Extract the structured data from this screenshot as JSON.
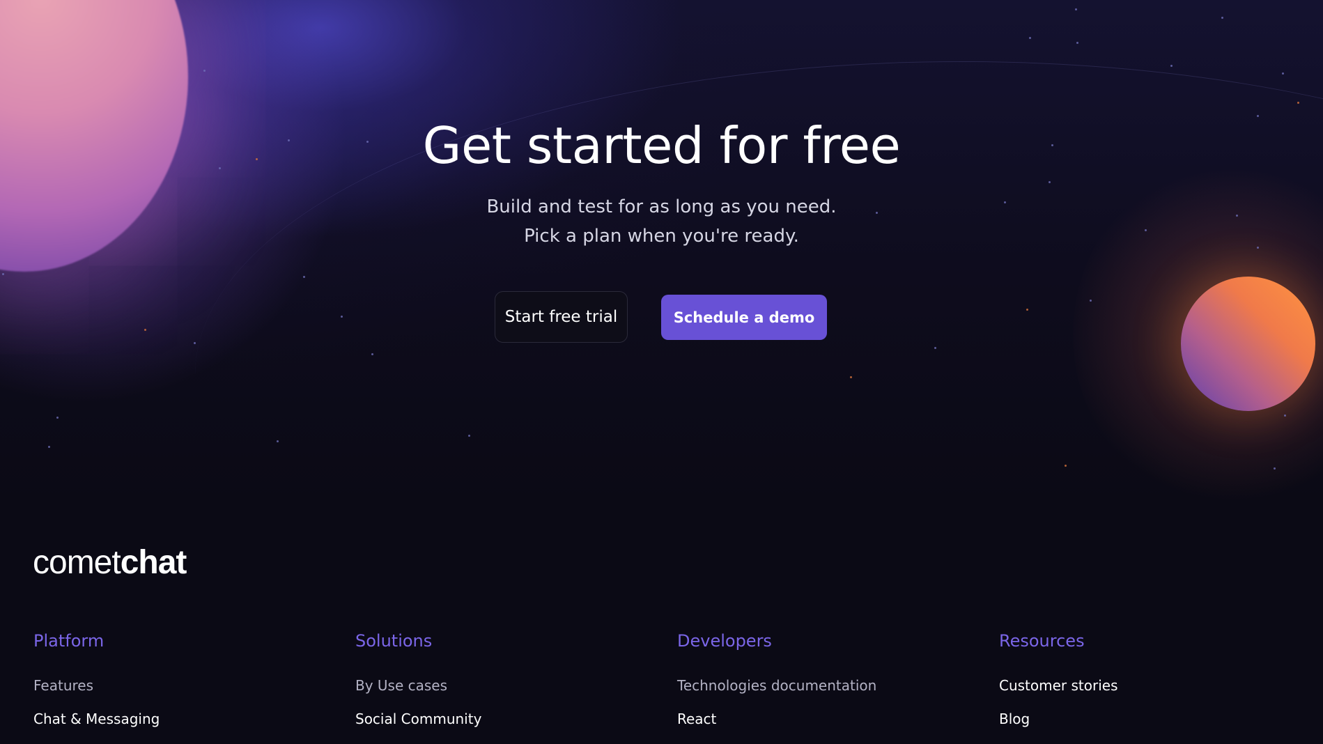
{
  "hero": {
    "title": "Get started for free",
    "subtitle_line1": "Build and test for as long as you need.",
    "subtitle_line2": "Pick a plan when you're ready.",
    "trial_button": "Start free trial",
    "demo_button": "Schedule a demo"
  },
  "colors": {
    "background": "#0b0a15",
    "accent": "#6851d6",
    "footer_heading": "#7b66e8"
  },
  "footer": {
    "logo": {
      "part1": "comet",
      "part2": "chat"
    },
    "columns": [
      {
        "title": "Platform",
        "items": [
          "Features",
          "Chat & Messaging"
        ]
      },
      {
        "title": "Solutions",
        "items": [
          "By Use cases",
          "Social Community"
        ]
      },
      {
        "title": "Developers",
        "items": [
          "Technologies documentation",
          "React"
        ]
      },
      {
        "title": "Resources",
        "items": [
          "Customer stories",
          "Blog"
        ]
      }
    ]
  }
}
